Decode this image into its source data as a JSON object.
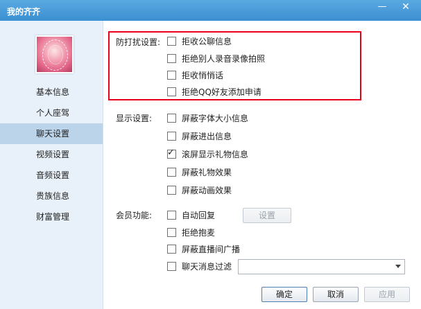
{
  "window": {
    "title": "我的齐齐",
    "minimize_icon": "—",
    "close_icon": "✕"
  },
  "sidebar": {
    "items": [
      {
        "label": "基本信息",
        "active": false
      },
      {
        "label": "个人座驾",
        "active": false
      },
      {
        "label": "聊天设置",
        "active": true
      },
      {
        "label": "视频设置",
        "active": false
      },
      {
        "label": "音频设置",
        "active": false
      },
      {
        "label": "贵族信息",
        "active": false
      },
      {
        "label": "财富管理",
        "active": false
      }
    ]
  },
  "anti_disturb": {
    "label": "防打扰设置:",
    "options": [
      {
        "label": "拒收公聊信息",
        "checked": false
      },
      {
        "label": "拒绝别人录音录像拍照",
        "checked": false
      },
      {
        "label": "拒收悄悄话",
        "checked": false
      },
      {
        "label": "拒绝QQ好友添加申请",
        "checked": false
      }
    ]
  },
  "display": {
    "label": "显示设置:",
    "options": [
      {
        "label": "屏蔽字体大小信息",
        "checked": false
      },
      {
        "label": "屏蔽进出信息",
        "checked": false
      },
      {
        "label": "滚屏显示礼物信息",
        "checked": true
      },
      {
        "label": "屏蔽礼物效果",
        "checked": false
      },
      {
        "label": "屏蔽动画效果",
        "checked": false
      }
    ]
  },
  "member": {
    "label": "会员功能:",
    "options": [
      {
        "label": "自动回复",
        "checked": false
      },
      {
        "label": "拒绝抱麦",
        "checked": false
      },
      {
        "label": "屏蔽直播间广播",
        "checked": false
      },
      {
        "label": "聊天消息过滤",
        "checked": false
      }
    ],
    "settings_button": "设置",
    "filter_value": ""
  },
  "footer": {
    "ok": "确定",
    "cancel": "取消",
    "apply": "应用"
  },
  "colors": {
    "titlebar": "#4a9bd9",
    "highlight_border": "#e8001c",
    "sidebar_active": "#bcd4ea"
  }
}
